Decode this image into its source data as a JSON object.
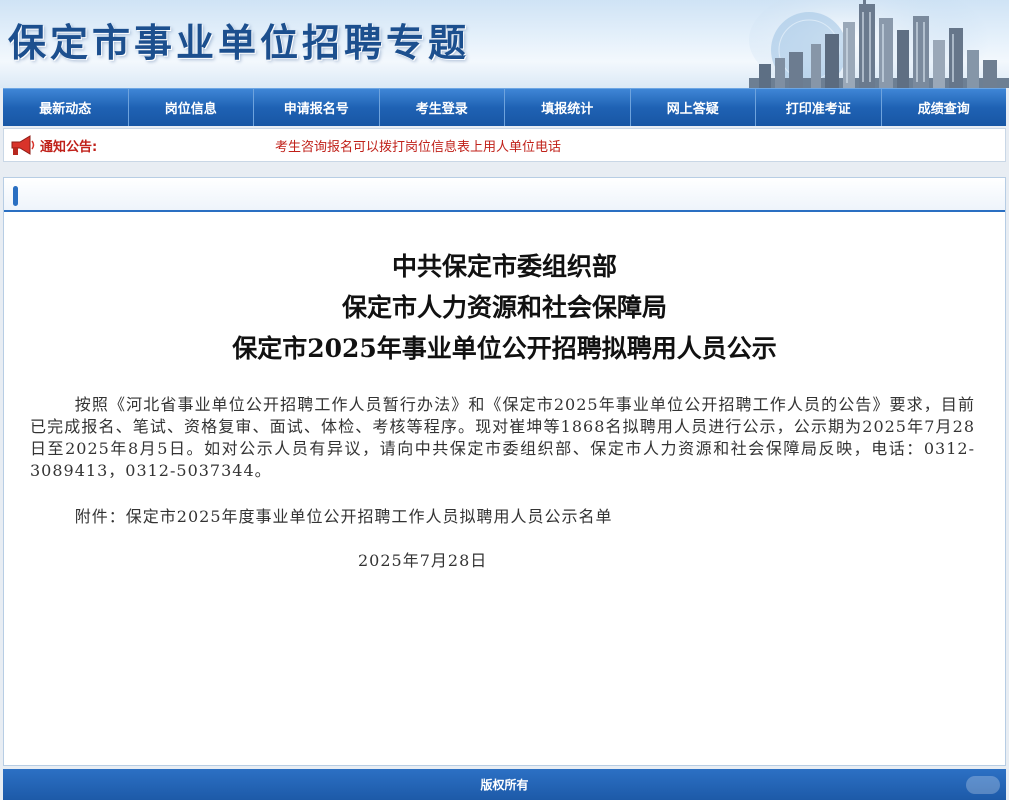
{
  "banner": {
    "title": "保定市事业单位招聘专题"
  },
  "nav": {
    "items": [
      {
        "label": "最新动态"
      },
      {
        "label": "岗位信息"
      },
      {
        "label": "申请报名号"
      },
      {
        "label": "考生登录"
      },
      {
        "label": "填报统计"
      },
      {
        "label": "网上答疑"
      },
      {
        "label": "打印准考证"
      },
      {
        "label": "成绩查询"
      }
    ]
  },
  "notice": {
    "label": "通知公告:",
    "text": "考生咨询报名可以拨打岗位信息表上用人单位电话"
  },
  "article": {
    "heading_line1": "中共保定市委组织部",
    "heading_line2": "保定市人力资源和社会保障局",
    "heading_line3": "保定市2025年事业单位公开招聘拟聘用人员公示",
    "paragraph": "按照《河北省事业单位公开招聘工作人员暂行办法》和《保定市2025年事业单位公开招聘工作人员的公告》要求，目前已完成报名、笔试、资格复审、面试、体检、考核等程序。现对崔坤等1868名拟聘用人员进行公示，公示期为2025年7月28日至2025年8月5日。如对公示人员有异议，请向中共保定市委组织部、保定市人力资源和社会保障局反映，电话：0312-3089413，0312-5037344。",
    "attachment": "附件：保定市2025年度事业单位公开招聘工作人员拟聘用人员公示名单",
    "date": "2025年7月28日"
  },
  "footer": {
    "text": "版权所有"
  },
  "colors": {
    "nav_blue": "#1f62b4",
    "title_blue": "#1c4f8e",
    "notice_red": "#c0211a"
  },
  "icons": [
    "megaphone-icon",
    "skyline-image",
    "back-to-top-icon"
  ]
}
